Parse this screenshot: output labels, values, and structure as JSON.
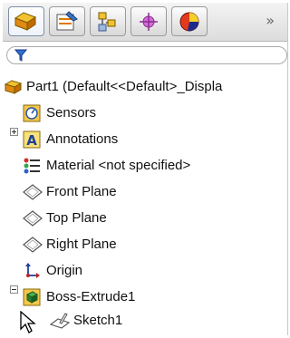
{
  "tabs": [
    {
      "icon": "featuremanager-tree-icon",
      "active": true
    },
    {
      "icon": "property-manager-icon",
      "active": false
    },
    {
      "icon": "configuration-manager-icon",
      "active": false
    },
    {
      "icon": "dimxpert-manager-icon",
      "active": false
    },
    {
      "icon": "display-manager-icon",
      "active": false
    }
  ],
  "overflow_glyph": "»",
  "filter": {
    "icon": "filter-icon",
    "value": ""
  },
  "tree": {
    "root": {
      "label": "Part1  (Default<<Default>_Displa",
      "icon": "part-icon"
    },
    "items": [
      {
        "label": "Sensors",
        "icon": "sensors-icon"
      },
      {
        "label": "Annotations",
        "icon": "annotations-icon",
        "expander": "plus"
      },
      {
        "label": "Material <not specified>",
        "icon": "material-icon"
      },
      {
        "label": "Front Plane",
        "icon": "plane-icon"
      },
      {
        "label": "Top Plane",
        "icon": "plane-icon"
      },
      {
        "label": "Right Plane",
        "icon": "plane-icon"
      },
      {
        "label": "Origin",
        "icon": "origin-icon"
      },
      {
        "label": "Boss-Extrude1",
        "icon": "boss-extrude-icon",
        "expander": "minus"
      },
      {
        "label": "Sketch1",
        "icon": "sketch-icon"
      }
    ]
  }
}
